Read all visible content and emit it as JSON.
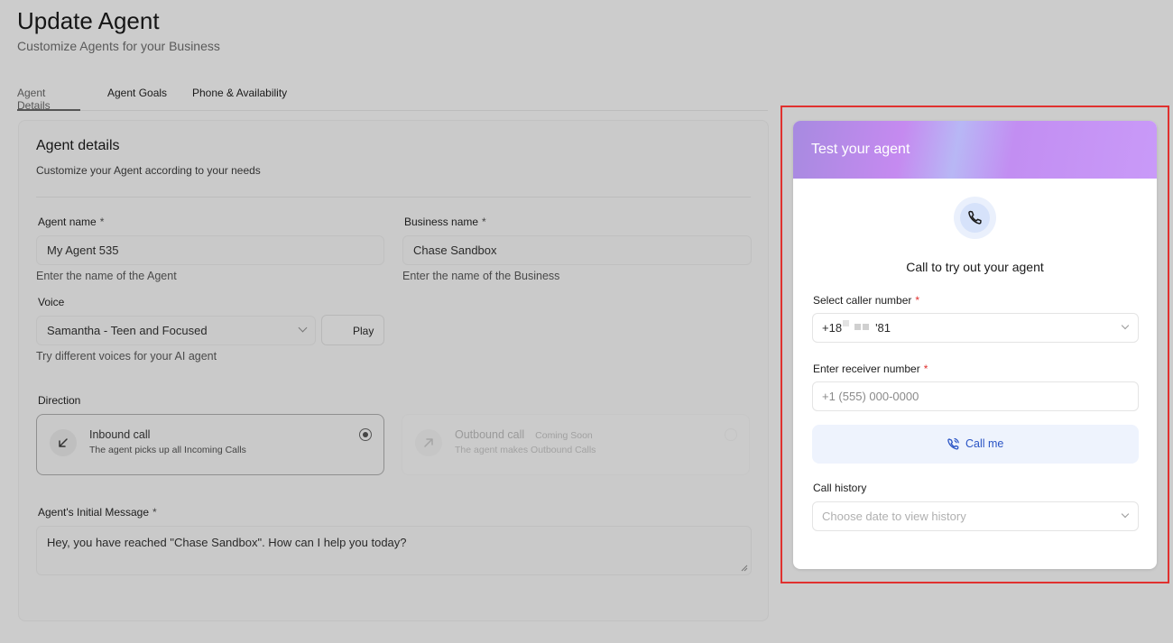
{
  "header": {
    "title": "Update Agent",
    "subtitle": "Customize Agents for your Business"
  },
  "tabs": [
    {
      "label": "Agent Details",
      "active": true
    },
    {
      "label": "Agent Goals",
      "active": false
    },
    {
      "label": "Phone & Availability",
      "active": false
    }
  ],
  "agent_details": {
    "title": "Agent details",
    "subtitle": "Customize your Agent according to your needs",
    "agent_name": {
      "label": "Agent name",
      "required_mark": "*",
      "value": "My Agent 535",
      "helper": "Enter the name of the Agent"
    },
    "business_name": {
      "label": "Business name",
      "required_mark": "*",
      "value": "Chase Sandbox",
      "helper": "Enter the name of the Business"
    },
    "voice": {
      "label": "Voice",
      "value": "Samantha - Teen and Focused",
      "play_label": "Play",
      "helper": "Try different voices for your AI agent"
    },
    "direction": {
      "label": "Direction",
      "inbound": {
        "title": "Inbound call",
        "description": "The agent picks up all Incoming Calls",
        "selected": true
      },
      "outbound": {
        "title": "Outbound call",
        "badge": "Coming Soon",
        "description": "The agent makes Outbound Calls",
        "selected": false
      }
    },
    "initial_message": {
      "label": "Agent's Initial Message",
      "required_mark": "*",
      "value": "Hey, you have reached \"Chase Sandbox\". How can I help you today?"
    }
  },
  "test_panel": {
    "header_title": "Test your agent",
    "call_title": "Call to try out your agent",
    "caller_number": {
      "label": "Select caller number",
      "required_mark": "*",
      "value_prefix": "+18",
      "value_suffix": "'81"
    },
    "receiver_number": {
      "label": "Enter receiver number",
      "required_mark": "*",
      "placeholder": "+1 (555) 000-0000"
    },
    "call_button_label": "Call me",
    "call_history": {
      "label": "Call history",
      "placeholder": "Choose date to view history"
    }
  },
  "colors": {
    "highlight_border": "#e0312f",
    "call_button_bg": "#eef3fd",
    "call_button_text": "#2a54c5",
    "required_red": "#e0312f"
  },
  "icons": [
    "phone-icon",
    "inbound-arrow-icon",
    "outbound-arrow-icon",
    "play-icon",
    "phone-call-icon",
    "chevron-down-icon"
  ]
}
